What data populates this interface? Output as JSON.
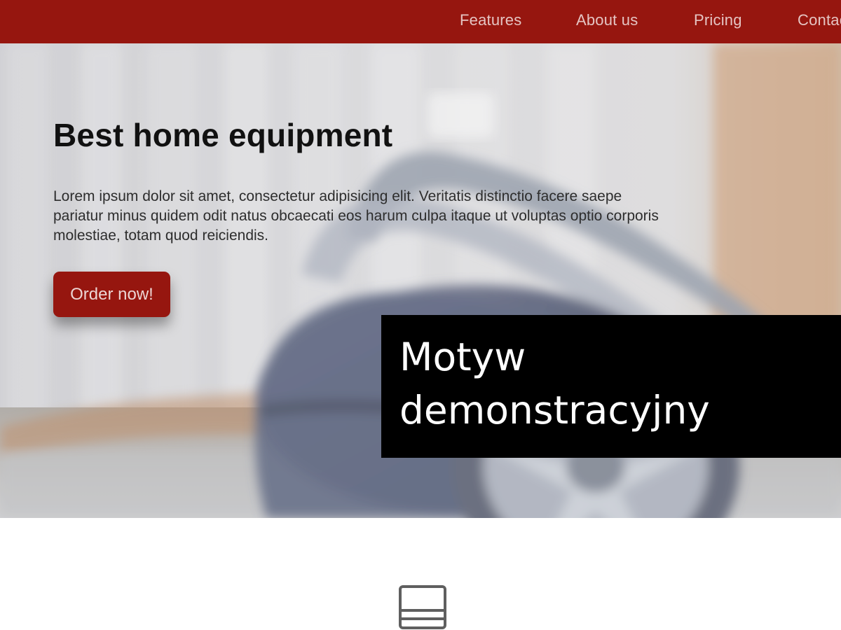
{
  "nav": {
    "items": [
      {
        "label": "Features"
      },
      {
        "label": "About us"
      },
      {
        "label": "Pricing"
      },
      {
        "label": "Contact"
      }
    ]
  },
  "hero": {
    "title": "Best home equipment",
    "description": "Lorem ipsum dolor sit amet, consectetur adipisicing elit. Veritatis distinctio facere saepe pariatur minus quidem odit natus obcaecati eos harum culpa itaque ut voluptas optio corporis molestiae, totam quod reiciendis.",
    "cta_label": "Order now!"
  },
  "overlay": {
    "line1": "Motyw",
    "line2": "demonstracyjny"
  },
  "icons": {
    "feature": "tablet-icon"
  },
  "colors": {
    "brand": "#96160f",
    "hero_text": "#2d2d2d",
    "title": "#111111",
    "overlay_bg": "#000000",
    "overlay_text": "#ffffff"
  }
}
